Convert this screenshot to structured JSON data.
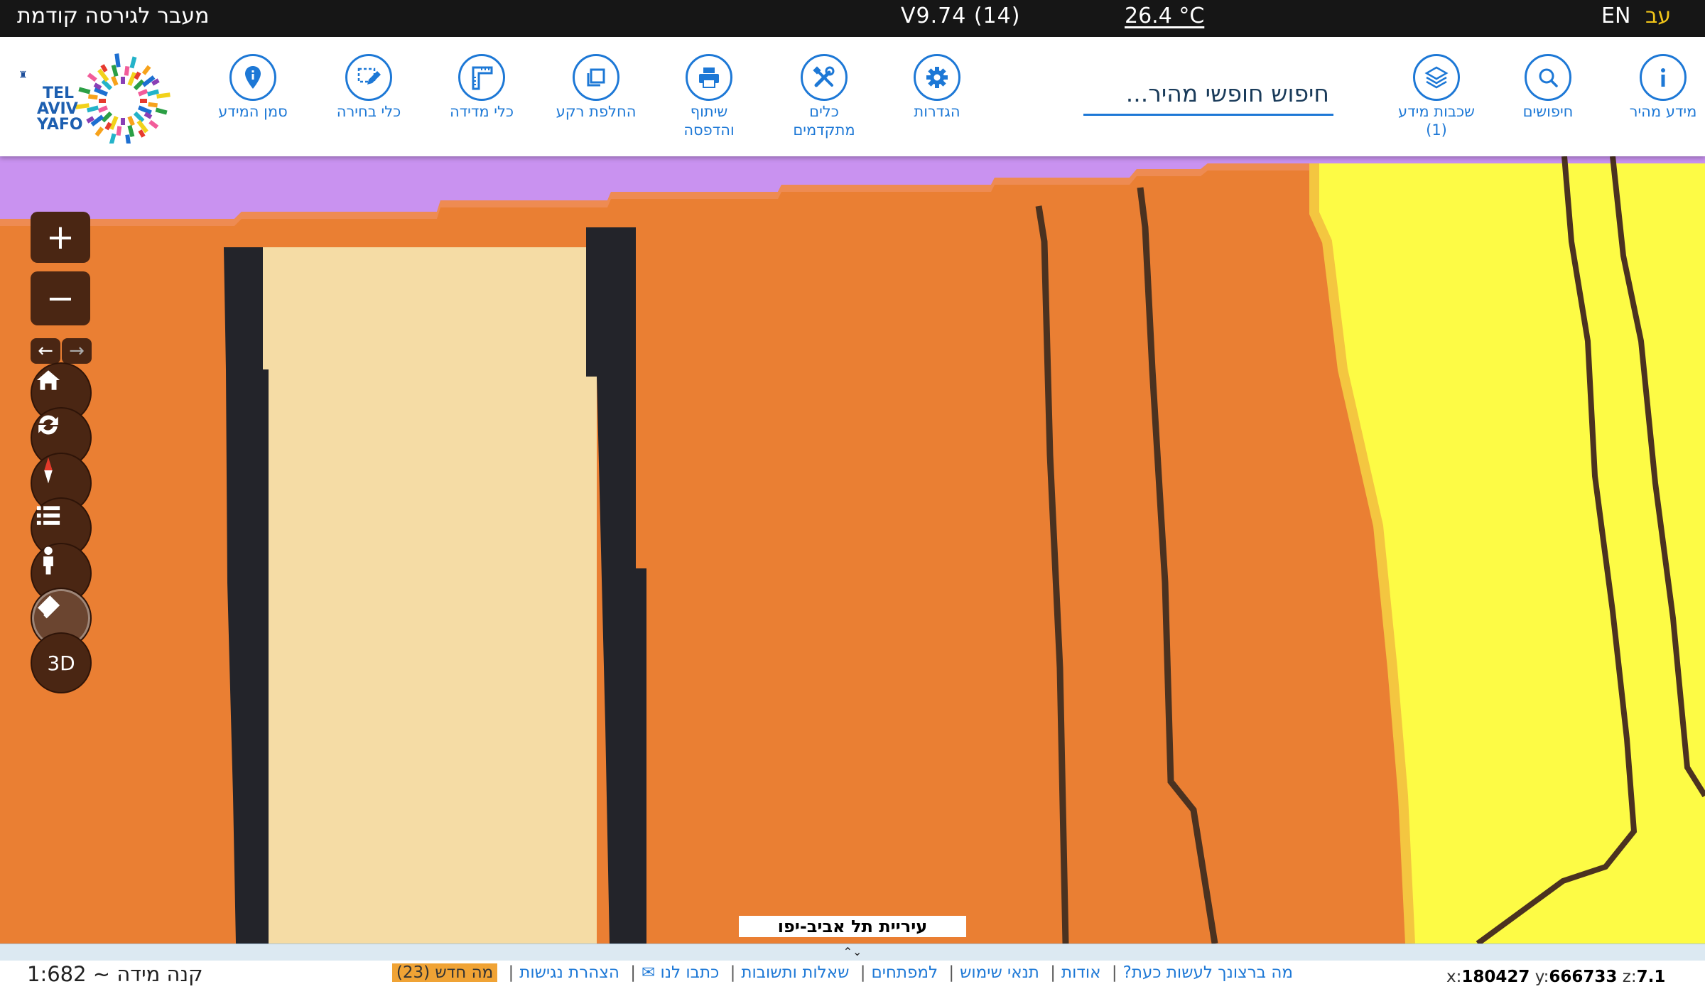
{
  "topbar": {
    "prev_version": "מעבר לגירסה קודמת",
    "version": "V9.74 (14)",
    "temperature": "26.4 °C",
    "lang_en": "EN",
    "lang_he": "עב"
  },
  "toolbar": {
    "logo_alt": "TEL AVIV YAFO תל אביב יפו",
    "tools": [
      {
        "label": "סמן המידע",
        "icon": "map-pin-icon"
      },
      {
        "label": "כלי בחירה",
        "icon": "select-edit-icon"
      },
      {
        "label": "כלי מדידה",
        "icon": "ruler-icon"
      },
      {
        "label": "החלפת רקע",
        "icon": "layers-swap-icon"
      },
      {
        "label": "שיתוף\nוהדפסה",
        "icon": "printer-icon"
      },
      {
        "label": "כלים\nמתקדמים",
        "icon": "tools-icon"
      },
      {
        "label": "הגדרות",
        "icon": "gear-icon"
      },
      {
        "label": "שכבות מידע\n(1)",
        "icon": "stack-layers-icon"
      },
      {
        "label": "חיפושים",
        "icon": "search-icon"
      },
      {
        "label": "מידע מהיר",
        "icon": "info-icon"
      }
    ],
    "search_placeholder": "חיפוש חופשי מהיר..."
  },
  "map": {
    "city_label": "עיריית תל אביב-יפו",
    "zoom_in": "+",
    "zoom_out": "−",
    "three_d": "3D",
    "back": "←",
    "forward": "→",
    "collapse": "⌃⌄",
    "colors": {
      "orange": "#ea7f33",
      "light": "#f5dca5",
      "purple": "#c992f0",
      "yellow": "#fdfb45",
      "dark": "#23242a"
    }
  },
  "bottombar": {
    "scale": "קנה מידה ~ 1:682",
    "links": [
      "מה ברצונך לעשות כעת?",
      "אודות",
      "תנאי שימוש",
      "למפתחים",
      "שאלות ותשובות",
      "כתבו לנו ✉",
      "הצהרת נגישות"
    ],
    "whats_new": "מה חדש (23)",
    "coords": {
      "x_label": "x:",
      "x": "180427",
      "y_label": " y:",
      "y": "666733",
      "z_label": " z:",
      "z": "7.1"
    }
  }
}
